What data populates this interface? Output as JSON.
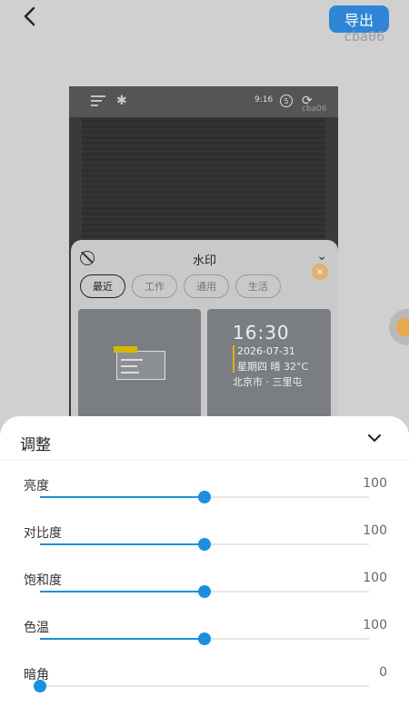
{
  "header": {
    "export_label": "导出",
    "watermark_id": "cba06"
  },
  "preview": {
    "status_time": "9:16",
    "battery": "5",
    "status_id": "cba06"
  },
  "watermark_panel": {
    "title": "水印",
    "tabs": [
      {
        "label": "最近",
        "active": true
      },
      {
        "label": "工作",
        "active": false
      },
      {
        "label": "通用",
        "active": false
      },
      {
        "label": "生活",
        "active": false
      }
    ],
    "card2": {
      "time": "16:30",
      "date": "2026-07-31",
      "weather": "星期四 晴 32°C",
      "location": "北京市 · 三里屯"
    }
  },
  "adjust": {
    "title": "调整",
    "items": [
      {
        "label": "亮度",
        "value": "100",
        "fraction": 0.5
      },
      {
        "label": "对比度",
        "value": "100",
        "fraction": 0.5
      },
      {
        "label": "饱和度",
        "value": "100",
        "fraction": 0.5
      },
      {
        "label": "色温",
        "value": "100",
        "fraction": 0.5
      },
      {
        "label": "暗角",
        "value": "0",
        "fraction": 0.0
      }
    ]
  },
  "colors": {
    "accent": "#1a8fdf",
    "export_bg": "#2f86d6",
    "highlight": "#e8a84f"
  }
}
